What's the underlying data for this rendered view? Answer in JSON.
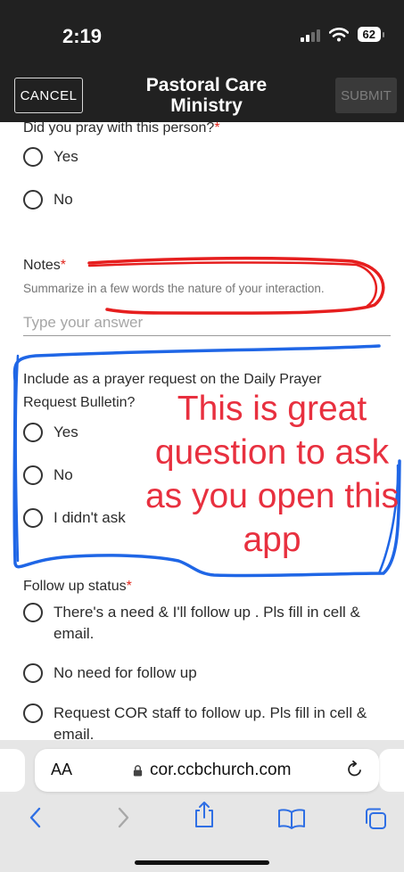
{
  "status": {
    "time": "2:19",
    "battery": "62"
  },
  "header": {
    "cancel_label": "CANCEL",
    "title": "Pastoral Care Ministry",
    "submit_label": "SUBMIT"
  },
  "form": {
    "q_pray": {
      "label": "Did you pray with this person?",
      "options": [
        "Yes",
        "No"
      ]
    },
    "q_notes": {
      "label": "Notes",
      "hint": "Summarize in a few words the nature of your interaction.",
      "placeholder": "Type your answer"
    },
    "q_prayer_request": {
      "label": "Include as a prayer request on the Daily Prayer Request Bulletin?",
      "options": [
        "Yes",
        "No",
        "I didn't ask"
      ]
    },
    "q_follow_up": {
      "label": "Follow up status",
      "options": [
        "There's a need & I'll follow up . Pls fill in cell & email.",
        "No need for follow up",
        "Request COR staff to follow up. Pls fill in cell & email."
      ]
    },
    "required_mark": "*"
  },
  "annotation": {
    "text": "This is great question to ask as you open this app",
    "red_color": "#e8303f",
    "blue_color": "#1f66e6"
  },
  "browser": {
    "aa_label": "AA",
    "url": "cor.ccbchurch.com"
  },
  "colors": {
    "header_bg": "#212121",
    "required": "#e0251b"
  },
  "icons": [
    "signal-icon",
    "wifi-icon",
    "battery-icon",
    "lock-icon",
    "reload-icon",
    "back-icon",
    "forward-icon",
    "share-icon",
    "bookmarks-icon",
    "tabs-icon"
  ]
}
